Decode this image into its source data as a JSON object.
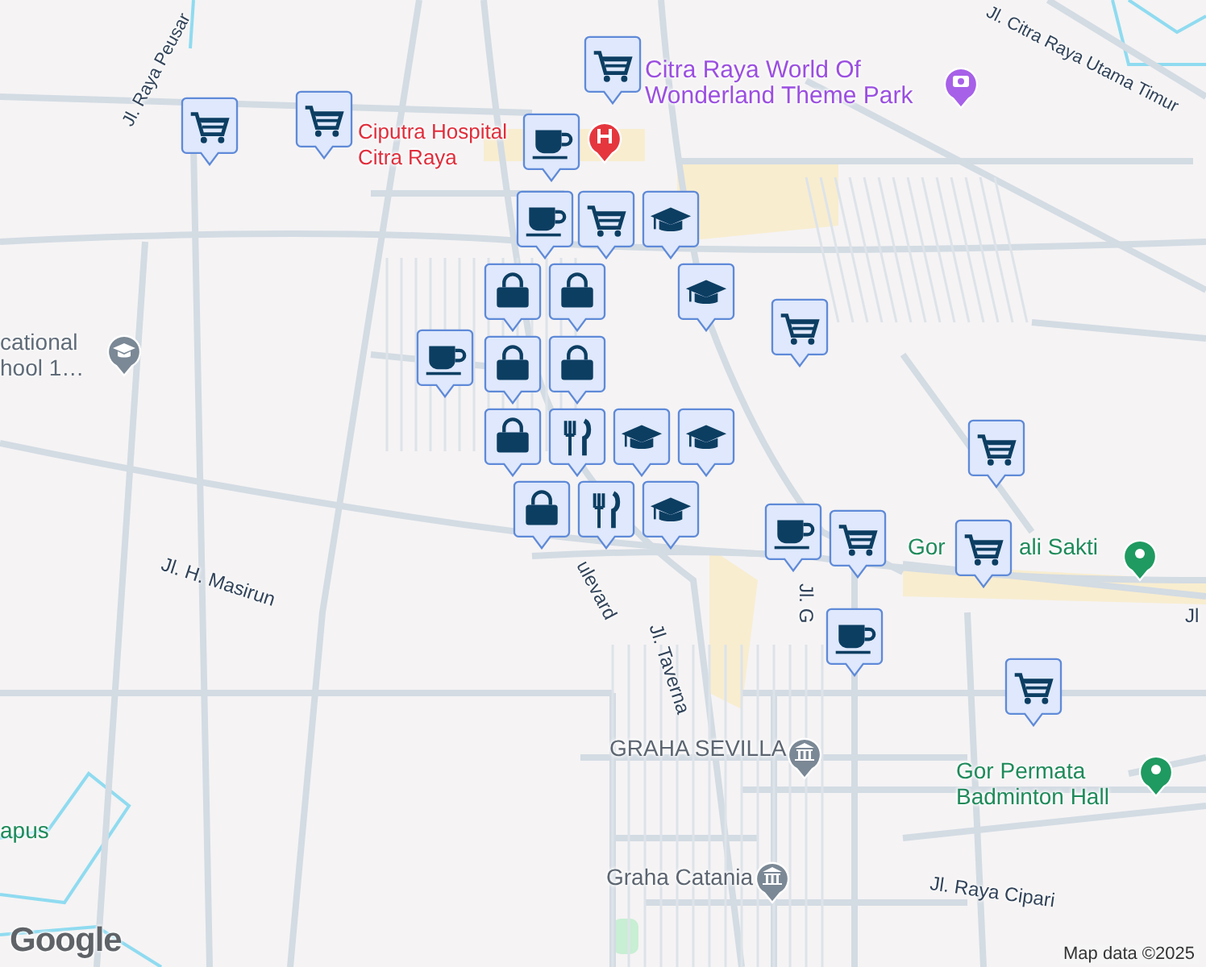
{
  "map": {
    "labels": [
      {
        "kind": "road",
        "text": "Jl. Raya Peusar"
      },
      {
        "kind": "road",
        "text": "Jl. Citra Raya Utama Timur"
      },
      {
        "kind": "attraction",
        "text": "Citra Raya World Of Wonderland Theme Park"
      },
      {
        "kind": "hospital",
        "text": "Ciputra Hospital Citra Raya"
      },
      {
        "kind": "school",
        "text": "cational hool 1…"
      },
      {
        "kind": "road",
        "text": "Jl. H. Masirun"
      },
      {
        "kind": "road",
        "text": "ulevard"
      },
      {
        "kind": "road",
        "text": "Jl. Taverna"
      },
      {
        "kind": "road",
        "text": "Jl. G"
      },
      {
        "kind": "sport",
        "text": "Gor"
      },
      {
        "kind": "sport",
        "text": "ali Sakti"
      },
      {
        "kind": "road",
        "text": "Jl"
      },
      {
        "kind": "landmark",
        "text": "GRAHA SEVILLA"
      },
      {
        "kind": "sport",
        "text": "Gor Permata Badminton Hall"
      },
      {
        "kind": "landmark",
        "text": "Graha Catania"
      },
      {
        "kind": "road",
        "text": "Jl. Raya Cipari"
      },
      {
        "kind": "park",
        "text": "apus"
      }
    ],
    "markers": [
      {
        "kind": "cart"
      },
      {
        "kind": "cart"
      },
      {
        "kind": "cup"
      },
      {
        "kind": "cup"
      },
      {
        "kind": "cart"
      },
      {
        "kind": "cap"
      },
      {
        "kind": "bag"
      },
      {
        "kind": "bag"
      },
      {
        "kind": "bag"
      },
      {
        "kind": "bag"
      },
      {
        "kind": "bag"
      },
      {
        "kind": "food"
      },
      {
        "kind": "bag"
      },
      {
        "kind": "cup"
      },
      {
        "kind": "cap"
      },
      {
        "kind": "cart"
      },
      {
        "kind": "cap"
      },
      {
        "kind": "cap"
      },
      {
        "kind": "cap"
      },
      {
        "kind": "food"
      },
      {
        "kind": "cart"
      },
      {
        "kind": "cup"
      },
      {
        "kind": "cart"
      },
      {
        "kind": "cart"
      },
      {
        "kind": "cart"
      },
      {
        "kind": "cart"
      },
      {
        "kind": "cup"
      }
    ],
    "logo": "Google",
    "attribution": "Map data ©2025"
  }
}
